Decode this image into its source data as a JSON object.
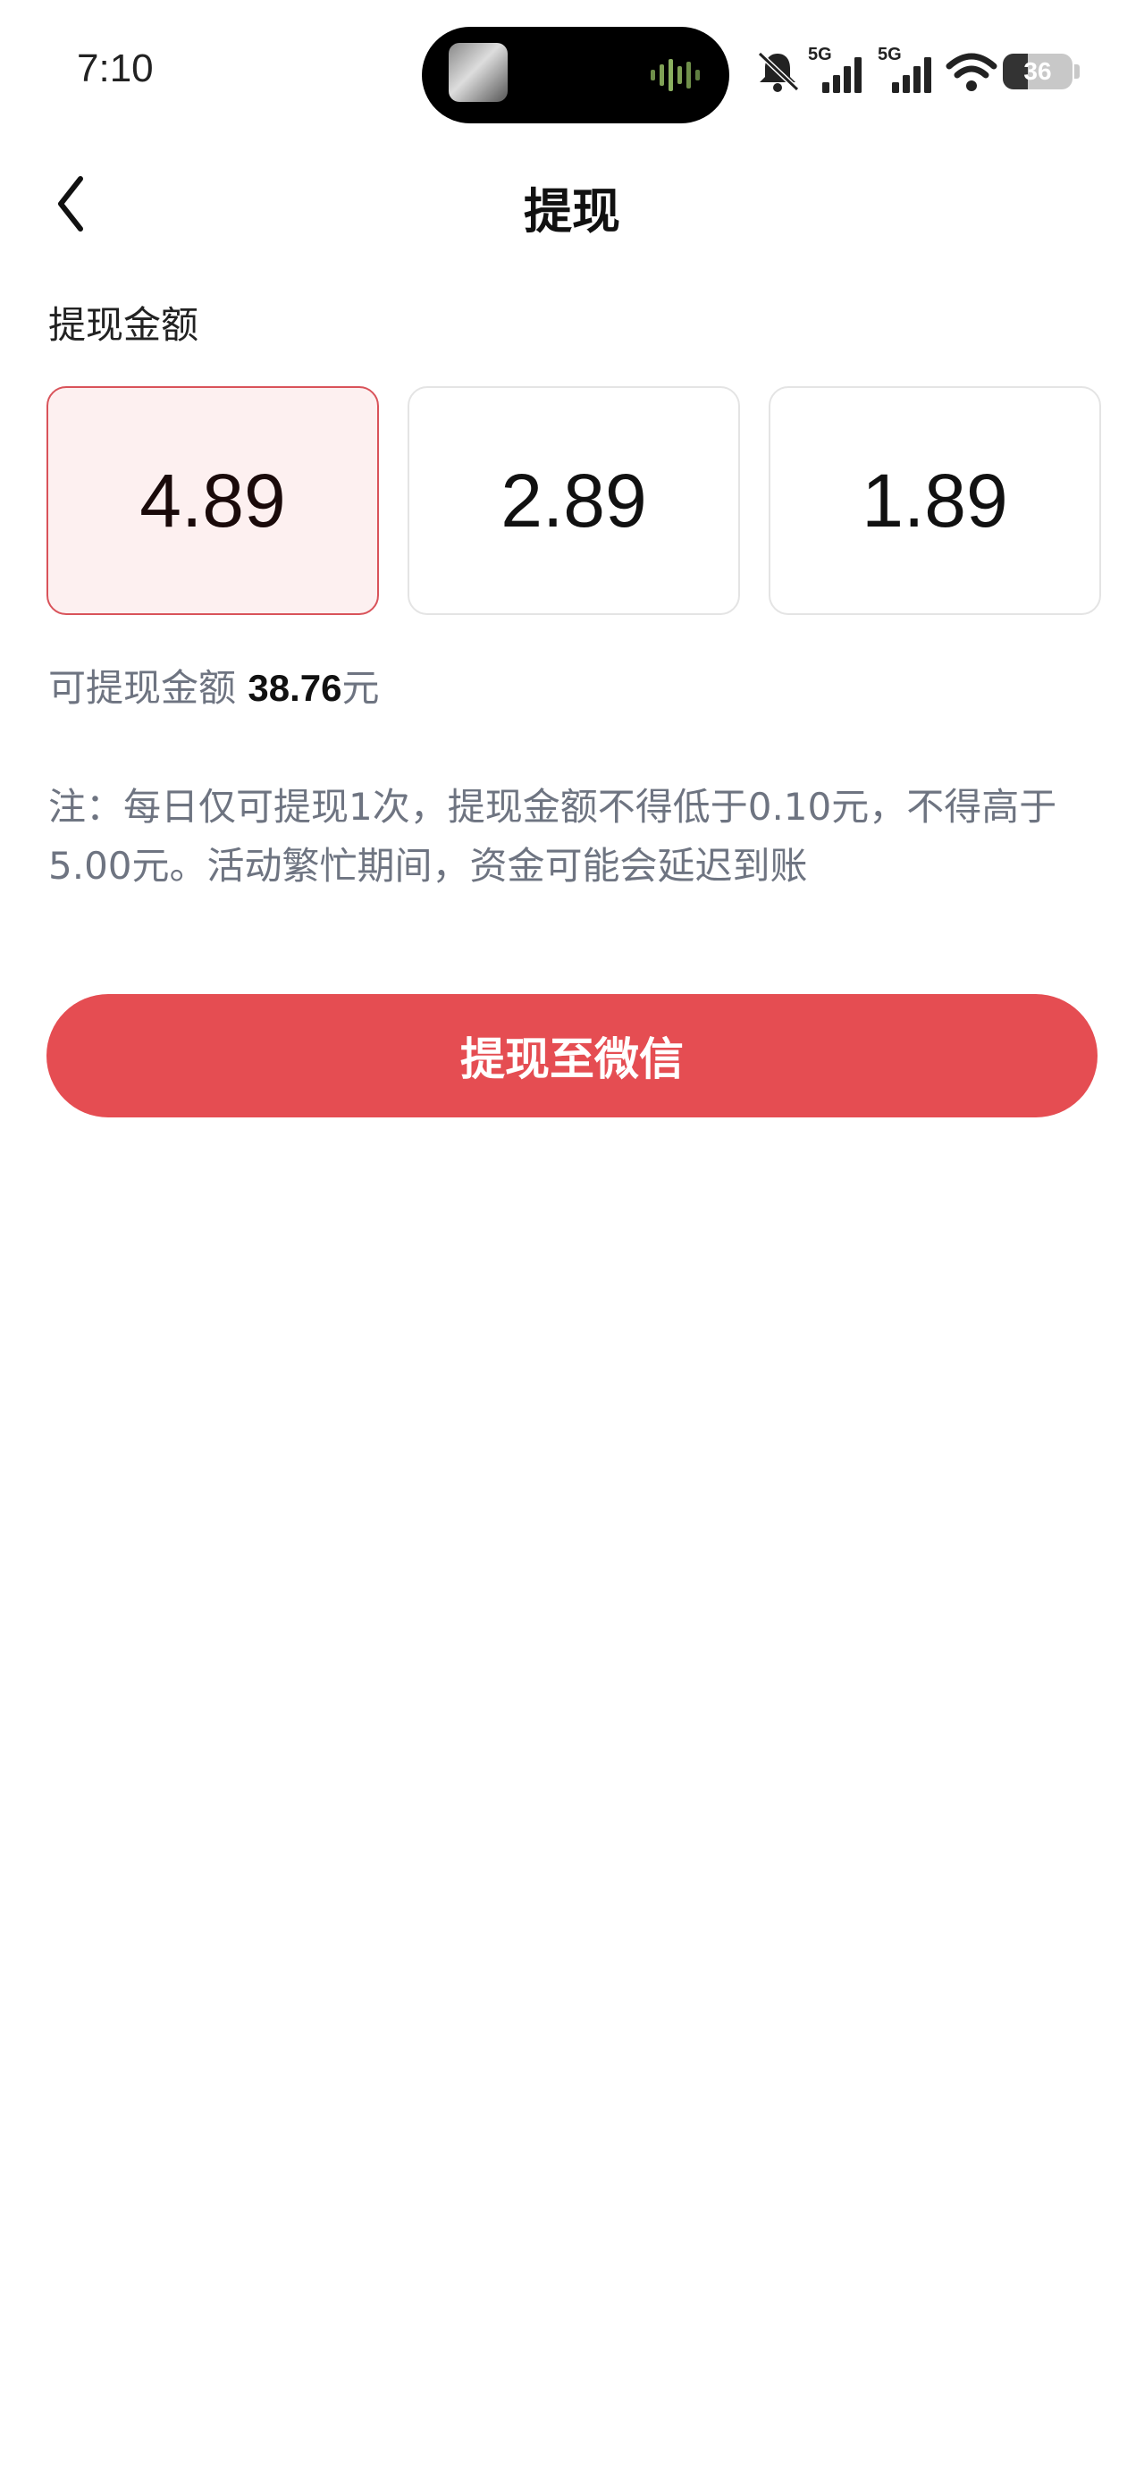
{
  "status_bar": {
    "time": "7:10",
    "battery": "36",
    "battery_level": 0.36,
    "network_labels": [
      "5G",
      "5G"
    ],
    "icons": [
      "mute-icon",
      "signal-icon",
      "signal-icon",
      "wifi-icon",
      "battery-icon"
    ]
  },
  "header": {
    "title": "提现",
    "back_icon": "chevron-left-icon"
  },
  "section": {
    "label": "提现金额"
  },
  "amount_options": [
    {
      "label": "4.89",
      "selected": true
    },
    {
      "label": "2.89",
      "selected": false
    },
    {
      "label": "1.89",
      "selected": false
    }
  ],
  "balance": {
    "label": "可提现金额",
    "value": "38.76",
    "unit": "元"
  },
  "note": {
    "text": "注：每日仅可提现1次，提现金额不得低于0.10元，不得高于5.00元。活动繁忙期间，资金可能会延迟到账"
  },
  "action": {
    "label": "提现至微信"
  },
  "colors": {
    "accent": "#e54d52",
    "selected_bg": "#fdf0f0",
    "selected_border": "#d9535a",
    "muted_text": "#6e7481"
  }
}
